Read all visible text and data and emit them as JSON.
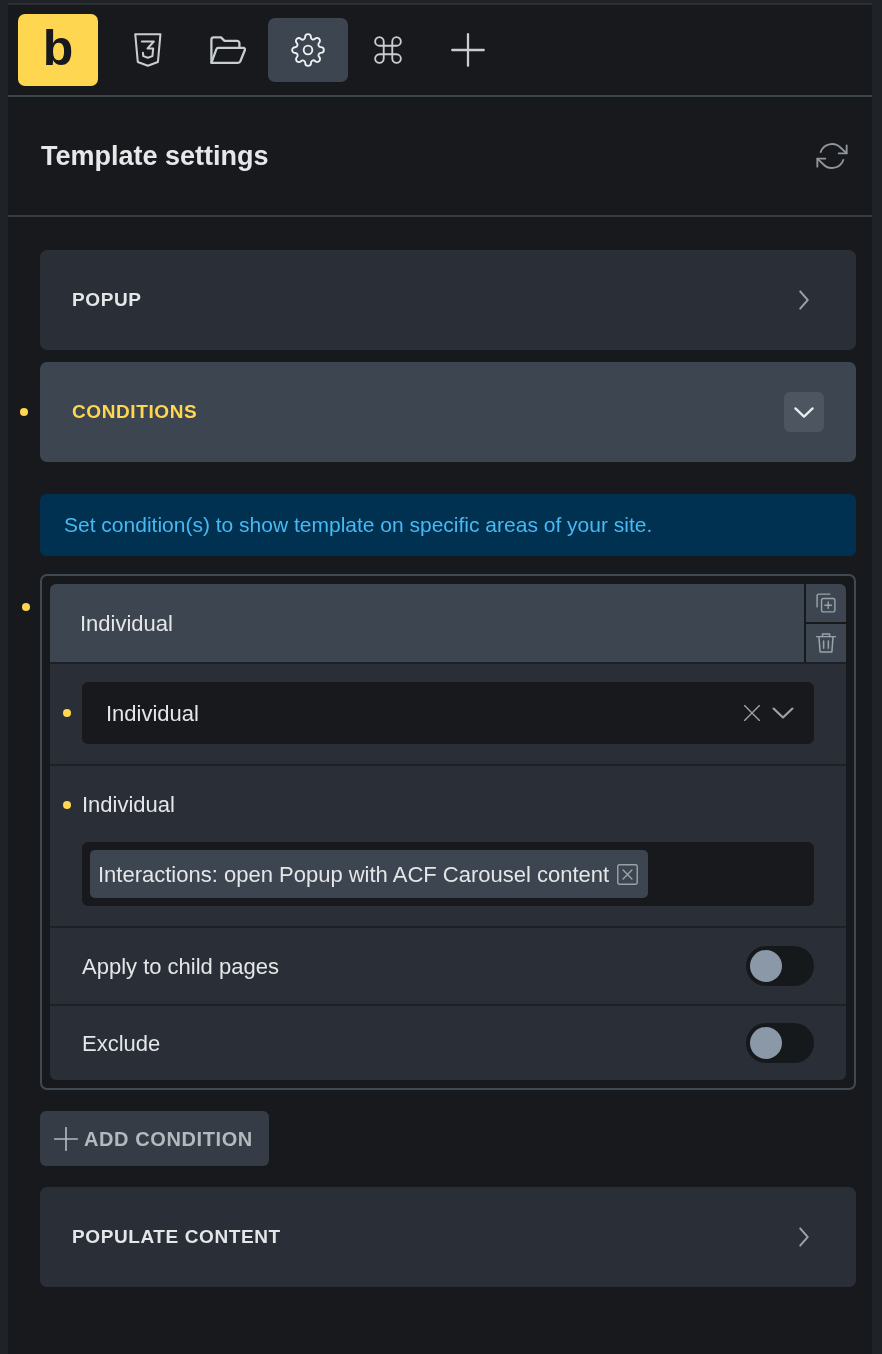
{
  "toolbar": {
    "logo": "b",
    "items": [
      {
        "kind": "css",
        "selected": false
      },
      {
        "kind": "folder",
        "selected": false
      },
      {
        "kind": "settings",
        "selected": true
      },
      {
        "kind": "command",
        "selected": false
      },
      {
        "kind": "add",
        "selected": false
      }
    ]
  },
  "header": {
    "title": "Template settings"
  },
  "sections": [
    {
      "title": "POPUP",
      "expanded": false,
      "modified": false
    },
    {
      "title": "CONDITIONS",
      "expanded": true,
      "modified": true,
      "notice": "Set condition(s) to show template on specific areas of your site.",
      "conditions": [
        {
          "title": "Individual",
          "modified": true,
          "fields": [
            {
              "kind": "select",
              "value": "Individual",
              "modified": true
            },
            {
              "kind": "tags",
              "label": "Individual",
              "modified": true,
              "tags": [
                "Interactions: open Popup with ACF Carousel content"
              ]
            },
            {
              "kind": "toggle",
              "label": "Apply to child pages",
              "on": false
            },
            {
              "kind": "toggle",
              "label": "Exclude",
              "on": false
            }
          ]
        }
      ],
      "add_button": "ADD CONDITION"
    },
    {
      "title": "POPULATE CONTENT",
      "expanded": false,
      "modified": false
    }
  ]
}
